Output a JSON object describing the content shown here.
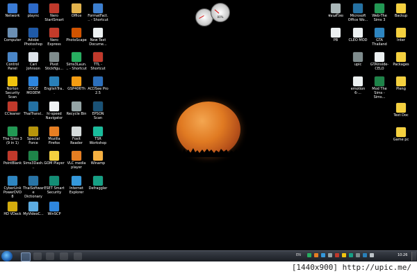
{
  "desktop_icons": {
    "left": [
      {
        "id": "network",
        "label": "Network",
        "color": "#3a7bd5"
      },
      {
        "id": "plaync",
        "label": "plaync",
        "color": "#2d6ac9"
      },
      {
        "id": "nero-startsmart",
        "label": "Nero StartSmart",
        "color": "#c0392b"
      },
      {
        "id": "office",
        "label": "Office",
        "color": "#e3b34c"
      },
      {
        "id": "formatfactory",
        "label": "FormatFact... - Shortcut",
        "color": "#3c7fd0"
      },
      {
        "id": "computer",
        "label": "Computer",
        "color": "#6b8fb3"
      },
      {
        "id": "adobe-photoshop",
        "label": "Adobe Photoshop ...",
        "color": "#1f5aa8"
      },
      {
        "id": "nero-express",
        "label": "Nero Express",
        "color": "#c33b2a"
      },
      {
        "id": "photoscape",
        "label": "PhotoScape",
        "color": "#d35400"
      },
      {
        "id": "new-text-document",
        "label": "New Text Docume...",
        "color": "#ecf0f1"
      },
      {
        "id": "control-panel",
        "label": "Control Panel",
        "color": "#4a86c8"
      },
      {
        "id": "cari-johnson",
        "label": "Cari Johnson",
        "color": "#dde3ea"
      },
      {
        "id": "pivot-stickfigure",
        "label": "Pivot Stickfigu...",
        "color": "#7f8c8d"
      },
      {
        "id": "sims3launcher",
        "label": "Sims3Laun... - Shortcut",
        "color": "#27ae60"
      },
      {
        "id": "ttl-shortcut",
        "label": "TTL - Shortcut",
        "color": "#c0392b"
      },
      {
        "id": "norton",
        "label": "Norton Security Scan",
        "color": "#f1c40f"
      },
      {
        "id": "edge-modem",
        "label": "EDGE MODEM",
        "color": "#2e86de"
      },
      {
        "id": "englishtranslator",
        "label": "EnglishTra...",
        "color": "#2980b9"
      },
      {
        "id": "gsp",
        "label": "GSP406Th",
        "color": "#f39c12"
      },
      {
        "id": "acdsee",
        "label": "ACDSee Pro 2.5",
        "color": "#2c6fbb"
      },
      {
        "id": "ccleaner",
        "label": "CCleaner",
        "color": "#c0392b"
      },
      {
        "id": "thaitranslator",
        "label": "ThaiTransl...",
        "color": "#2471a3"
      },
      {
        "id": "hi-speed-navigator",
        "label": "hi-speed Navigator",
        "color": "#f0f3f4"
      },
      {
        "id": "recycle-bin",
        "label": "Recycle Bin",
        "color": "#95a5a6"
      },
      {
        "id": "epson-scan",
        "label": "EPSON Scan",
        "color": "#1a5276"
      },
      {
        "id": "the-sims-3",
        "label": "The Sims 3 (9 in 1)",
        "color": "#229954"
      },
      {
        "id": "special-force",
        "label": "Special Force",
        "color": "#b7950b"
      },
      {
        "id": "mozilla-firefox",
        "label": "Mozilla Firefox",
        "color": "#e67e22"
      },
      {
        "id": "foxit-reader",
        "label": "Foxit Reader",
        "color": "#d5dbdb"
      },
      {
        "id": "tsr-workshop",
        "label": "TSR Workshop",
        "color": "#1abc9c"
      },
      {
        "id": "pointblank",
        "label": "PointBlank",
        "color": "#c0392b"
      },
      {
        "id": "sims3dashboard",
        "label": "Sims3Dash...",
        "color": "#1e8449"
      },
      {
        "id": "gom-player",
        "label": "GOM Player",
        "color": "#f4d03f"
      },
      {
        "id": "vlc",
        "label": "VLC media player",
        "color": "#e67e22"
      },
      {
        "id": "winamp",
        "label": "Winamp",
        "color": "#f5b041"
      },
      {
        "id": "cyberlink",
        "label": "CyberLink PowerDVD 8",
        "color": "#2e86c1"
      },
      {
        "id": "thaisoftware",
        "label": "ThaiSoftware Dictionary",
        "color": "#2874a6"
      },
      {
        "id": "eset",
        "label": "ESET Smart Security",
        "color": "#138d75"
      },
      {
        "id": "ie",
        "label": "Internet Explorer",
        "color": "#3498db"
      },
      {
        "id": "defraggler",
        "label": "Defraggler",
        "color": "#16a085"
      },
      {
        "id": "hd-vdeck",
        "label": "HD VDeck",
        "color": "#d4ac0d"
      },
      {
        "id": "myvideoconverter",
        "label": "MyVideoC...",
        "color": "#5dade2"
      },
      {
        "id": "winscp",
        "label": "WinSCP",
        "color": "#2e86de"
      }
    ],
    "right": [
      {
        "id": "thai-folder",
        "label": "ฟอนต์ไทย",
        "color": "#aab7b8"
      },
      {
        "id": "ms-office-word",
        "label": "Microsoft Office Wo...",
        "color": "#2471a3"
      },
      {
        "id": "web-the-sims3",
        "label": "Web-The Sims 3",
        "color": "#229954"
      },
      {
        "id": "backup",
        "label": "Backup",
        "color": "#f4d03f"
      },
      {
        "id": "pb",
        "label": "PB",
        "color": "#ecf0f1"
      },
      {
        "id": "cleo-mod",
        "label": "CLEO MOD",
        "color": "#ecf0f1"
      },
      {
        "id": "gta-thailand",
        "label": "GTA Thailand",
        "color": "#2e86c1"
      },
      {
        "id": "inter",
        "label": "Inter",
        "color": "#f4d03f"
      },
      {
        "id": "upic",
        "label": "upic",
        "color": "#7f8c8d"
      },
      {
        "id": "gtainside",
        "label": "GTAinside-CELO",
        "color": "#ecf0f1"
      },
      {
        "id": "packages",
        "label": "Packages",
        "color": "#f4d03f"
      },
      {
        "id": "emotion",
        "label": "emotion 6-...",
        "color": "#ecf0f1"
      },
      {
        "id": "mod-the-sims",
        "label": "Mod The Sims - Sims...",
        "color": "#1e8449"
      },
      {
        "id": "pleng",
        "label": "Pleng",
        "color": "#f4d03f"
      },
      {
        "id": "text-doc",
        "label": "Text Doc",
        "color": "#f4d03f"
      },
      {
        "id": "game-pc",
        "label": "Game pc",
        "color": "#f4d03f"
      }
    ]
  },
  "gadgets": {
    "clock_label": "",
    "meter_label": "80%"
  },
  "taskbar": {
    "language": "EN",
    "clock": "10:26",
    "pinned": [
      "ie",
      "explorer",
      "media",
      "paint",
      "app5"
    ]
  },
  "footer": {
    "watermark": "[1440x900] http://upic.me/"
  }
}
